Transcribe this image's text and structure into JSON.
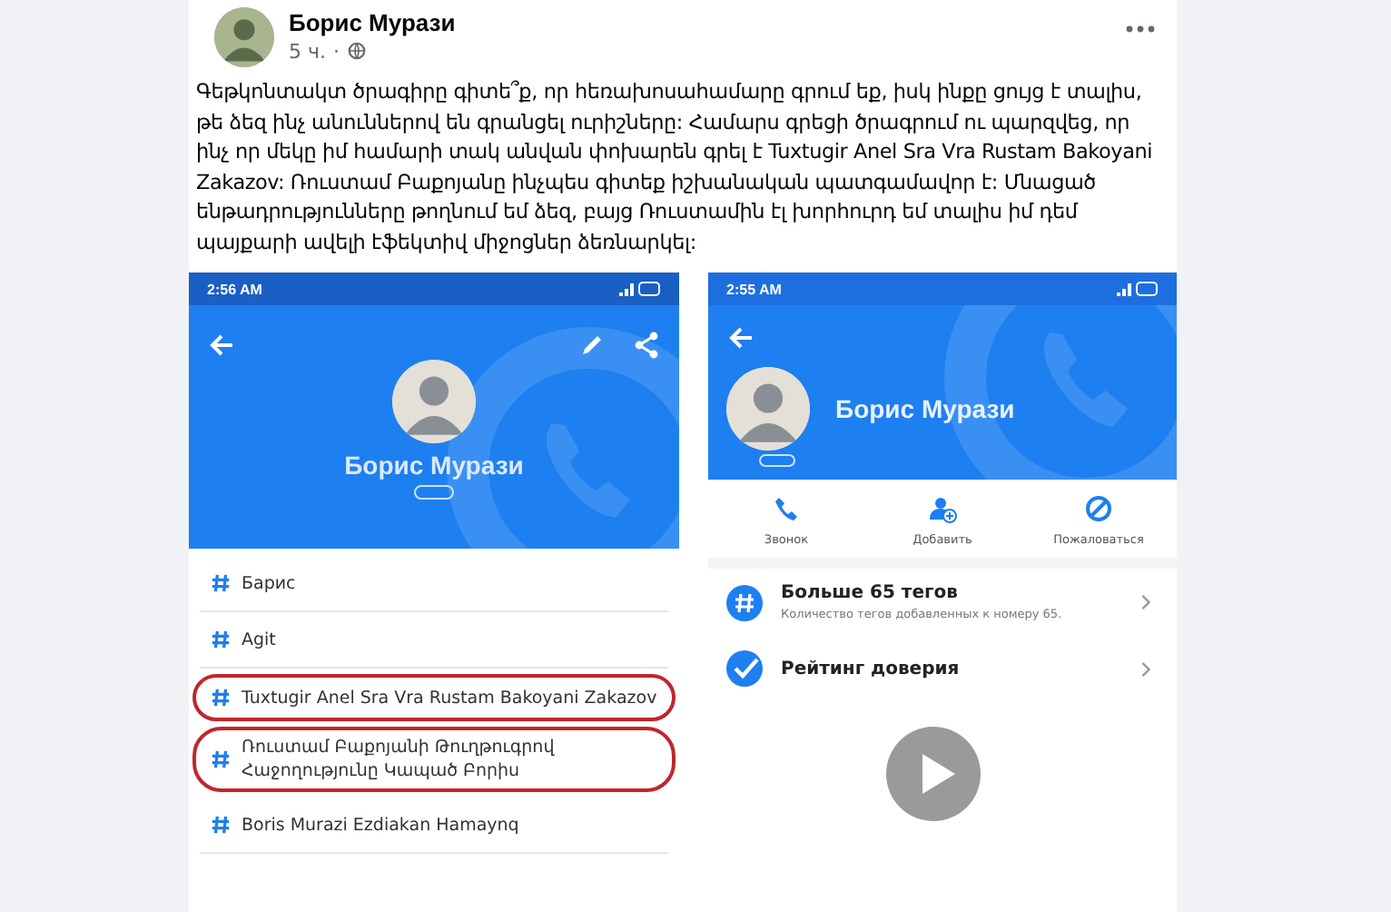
{
  "post": {
    "author": "Борис Мурази",
    "time": "5 ч.",
    "time_separator": "·",
    "text": "Գեթկոնտակտ ծրագիրը գիտե՞ք, որ հեռախոսահամարը գրում եք, իսկ ինքը ցույց  է տալիս, թե ձեզ ինչ անուններով են գրանցել ուրիշները: Համարս գրեցի ծրագրում ու պարզվեց, որ ինչ որ մեկը իմ համարի տակ անվան փոխարեն գրել է Tuxtugir Anel Sra Vra Rustam Bakoyani Zakazov: Ռուստամ Բաքոյանը ինչպես գիտեք իշխանական պատգամավոր է: Մնացած ենթադրությունները թողնում եմ ձեզ, բայց Ռուստամին էլ խորհուրդ եմ տալիս իմ դեմ պայքարի ավելի էֆեկտիվ միջոցներ ձեռնարկել:"
  },
  "screenshots": [
    {
      "kind": "tags",
      "status_time": "2:56 AM",
      "name": "Борис Мурази",
      "tags": [
        {
          "text": "Барис",
          "circled": false
        },
        {
          "text": "Agit",
          "circled": false
        },
        {
          "text": "Tuxtugir Anel Sra Vra Rustam Bakoyani Zakazov",
          "circled": true
        },
        {
          "text": "Ռուստամ Բաքոյանի Թուղթուգրով Հաջողությունը Կապած Բորիս",
          "circled": true
        },
        {
          "text": "Boris Murazi Ezdiakan Hamaynq",
          "circled": false
        }
      ]
    },
    {
      "kind": "profile",
      "status_time": "2:55 AM",
      "name": "Борис Мурази",
      "actions": [
        {
          "kind": "call",
          "label": "Звонок"
        },
        {
          "kind": "add",
          "label": "Добавить"
        },
        {
          "kind": "block",
          "label": "Пожаловаться"
        }
      ],
      "items": [
        {
          "kind": "tags",
          "title": "Больше 65 тегов",
          "subtitle": "Количество тегов добавленных к номеру 65."
        },
        {
          "kind": "trust",
          "title": "Рейтинг доверия"
        }
      ]
    }
  ]
}
